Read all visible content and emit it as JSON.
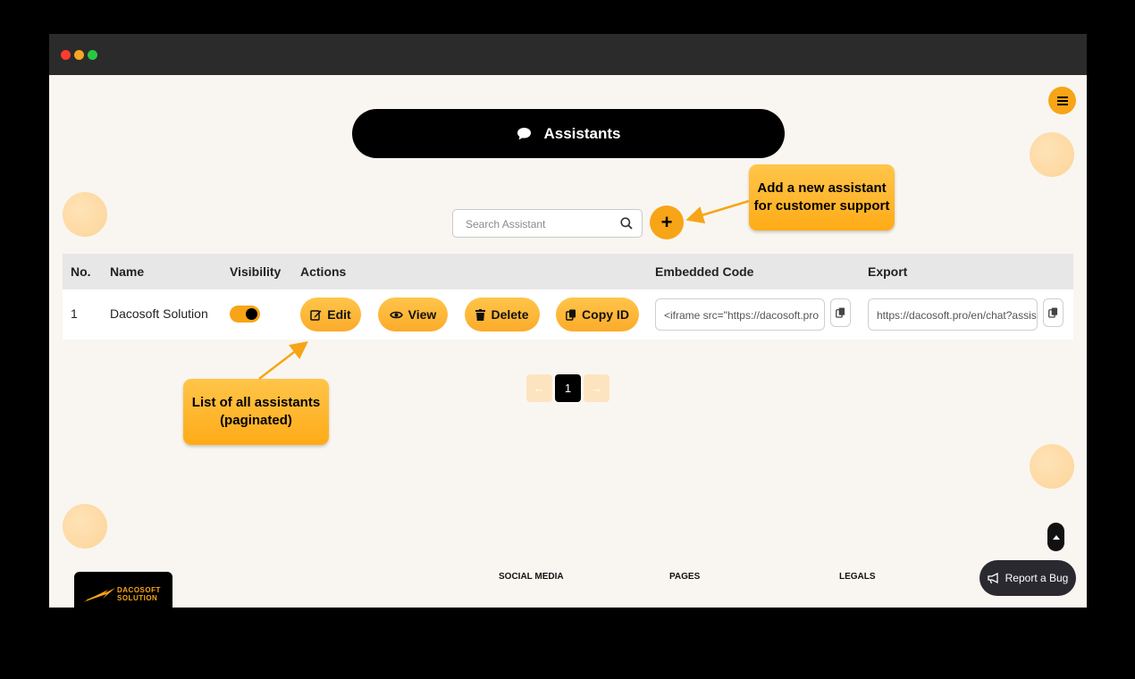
{
  "header": {
    "title": "Assistants",
    "title_icon": "chat-bubble-icon",
    "menu_icon": "hamburger-icon"
  },
  "search": {
    "placeholder": "Search Assistant",
    "value": "",
    "icon": "search-icon"
  },
  "add_button": {
    "label": "+",
    "icon": "plus-icon"
  },
  "callouts": {
    "add": [
      "Add a new assistant",
      "for customer support"
    ],
    "list": [
      "List of all assistants",
      "(paginated)"
    ]
  },
  "table": {
    "headers": [
      "No.",
      "Name",
      "Visibility",
      "Actions",
      "Embedded Code",
      "Export"
    ],
    "rows": [
      {
        "no": "1",
        "name": "Dacosoft Solution",
        "visible": true,
        "actions": [
          {
            "label": "Edit",
            "icon": "edit-icon"
          },
          {
            "label": "View",
            "icon": "eye-icon"
          },
          {
            "label": "Delete",
            "icon": "trash-icon"
          },
          {
            "label": "Copy ID",
            "icon": "copy-icon"
          }
        ],
        "embedded_code": "<iframe src=\"https://dacosoft.pro",
        "export": "https://dacosoft.pro/en/chat?assis"
      }
    ]
  },
  "pagination": {
    "prev": "←",
    "current": "1",
    "next": "→"
  },
  "footer": {
    "logo_lines": [
      "DACOSOFT",
      "SOLUTION"
    ],
    "headings": [
      "SOCIAL MEDIA",
      "PAGES",
      "LEGALS"
    ]
  },
  "report_bug": {
    "label": "Report a Bug",
    "icon": "megaphone-icon"
  },
  "colors": {
    "accent": "#f7a516",
    "dark": "#000000",
    "background": "#f9f6f1"
  }
}
